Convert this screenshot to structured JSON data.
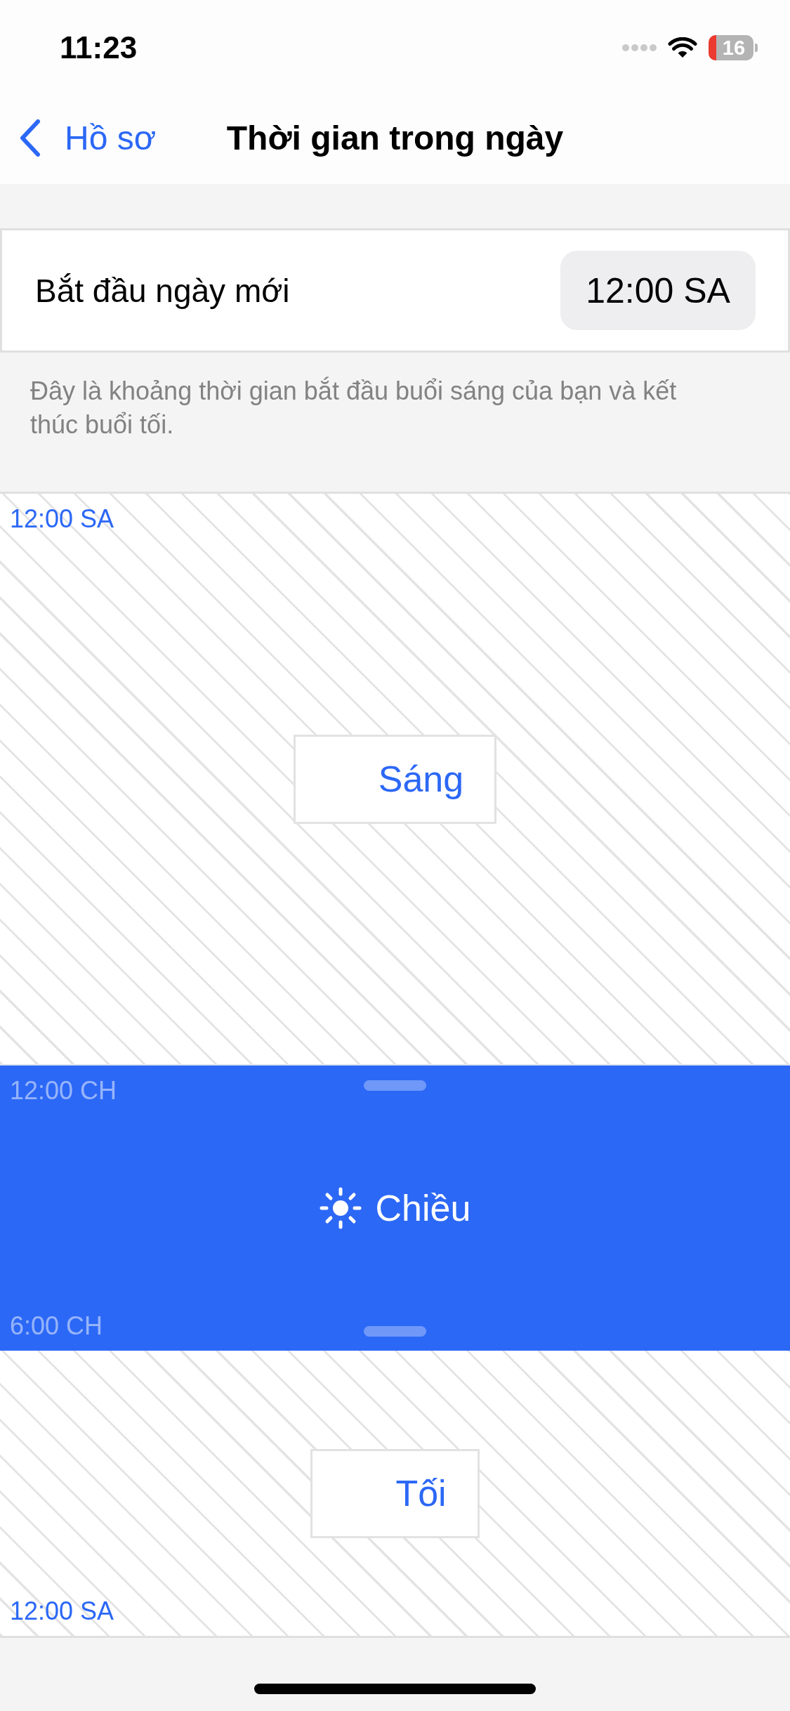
{
  "status_bar": {
    "time": "11:23",
    "battery": "16"
  },
  "nav_bar": {
    "back_label": "Hồ sơ",
    "title": "Thời gian trong ngày"
  },
  "day_start": {
    "label": "Bắt đầu ngày mới",
    "value": "12:00 SA",
    "description": "Đây là khoảng thời gian bắt đầu buổi sáng của bạn và kết thúc buổi tối."
  },
  "periods": [
    {
      "label": "Sáng",
      "selected": false,
      "start": "12:00 SA"
    },
    {
      "label": "Chiều",
      "selected": true,
      "start": "12:00 CH",
      "end": "6:00 CH"
    },
    {
      "label": "Tối",
      "selected": false,
      "end": "12:00 SA"
    }
  ]
}
